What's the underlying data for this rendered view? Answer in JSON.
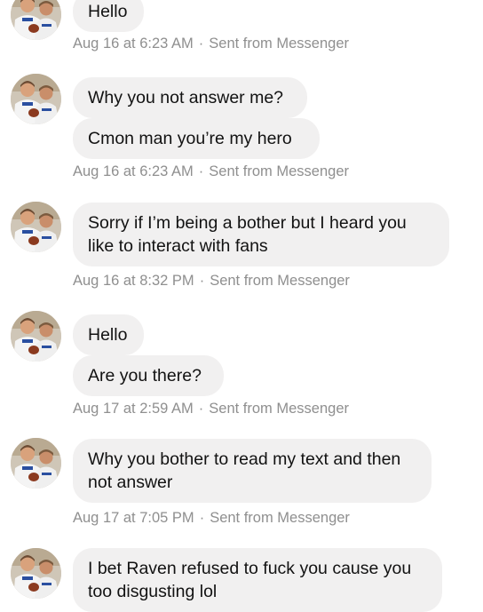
{
  "thread": {
    "groups": [
      {
        "messages": [
          "Hello"
        ],
        "timestamp": "Aug 16 at 6:23 AM",
        "source": "Sent from Messenger"
      },
      {
        "messages": [
          "Why you not answer me?",
          "Cmon man you’re my hero"
        ],
        "timestamp": "Aug 16 at 6:23 AM",
        "source": "Sent from Messenger"
      },
      {
        "messages": [
          "Sorry if I’m being a bother but I heard you like to interact with fans"
        ],
        "timestamp": "Aug 16 at 8:32 PM",
        "source": "Sent from Messenger"
      },
      {
        "messages": [
          "Hello",
          "Are you there?"
        ],
        "timestamp": "Aug 17 at 2:59 AM",
        "source": "Sent from Messenger"
      },
      {
        "messages": [
          "Why you bother to read my text and then not answer"
        ],
        "timestamp": "Aug 17 at 7:05 PM",
        "source": "Sent from Messenger"
      },
      {
        "messages": [
          "I bet Raven refused to fuck you cause you too disgusting lol"
        ],
        "timestamp": "",
        "source": ""
      }
    ],
    "separator": "·"
  }
}
